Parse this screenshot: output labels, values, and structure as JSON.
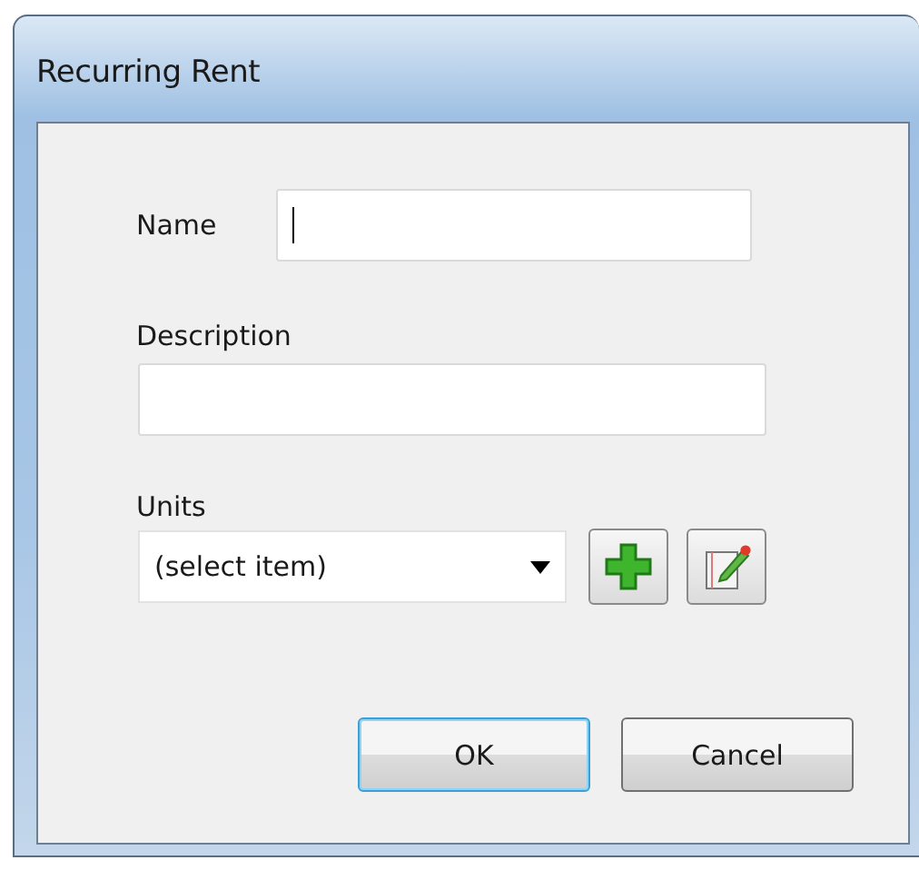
{
  "window": {
    "title": "Recurring Rent"
  },
  "name_field": {
    "label": "Name",
    "focused": true
  },
  "description_field": {
    "label": "Description",
    "focused": false
  },
  "units": {
    "label": "Units",
    "value": "(select item)"
  },
  "buttons": [
    {
      "label": "OK",
      "default": true
    },
    {
      "label": "Cancel",
      "default": false
    }
  ]
}
